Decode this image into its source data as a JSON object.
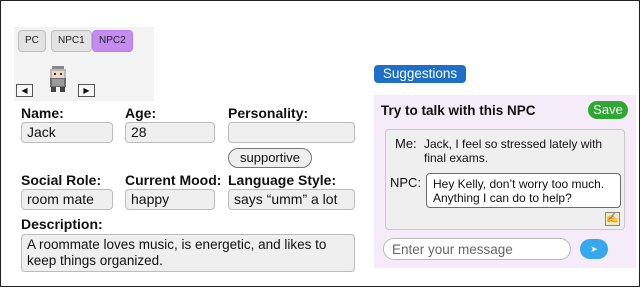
{
  "tabs": [
    "PC",
    "NPC1",
    "NPC2"
  ],
  "active_tab": "NPC2",
  "avatar": {
    "prev": "◀",
    "next": "▶"
  },
  "form": {
    "name": {
      "label": "Name:",
      "value": "Jack"
    },
    "age": {
      "label": "Age:",
      "value": "28"
    },
    "personality": {
      "label": "Personality:",
      "value": "",
      "tag": "supportive"
    },
    "social_role": {
      "label": "Social Role:",
      "value": "room mate"
    },
    "current_mood": {
      "label": "Current Mood:",
      "value": "happy"
    },
    "language_style": {
      "label": "Language Style:",
      "value": "says “umm” a lot"
    },
    "description": {
      "label": "Description:",
      "value": "A roommate loves music, is energetic, and likes to keep things organized."
    }
  },
  "suggestions": {
    "button_label": "Suggestions",
    "title": "Try to talk with this NPC",
    "save_label": "Save",
    "chat": {
      "me_label": "Me:",
      "me_text": "Jack, I feel so stressed lately with final exams.",
      "npc_label": "NPC:",
      "npc_text": "Hey Kelly, don’t worry too much. Anything I can do to help?",
      "edit_icon": "✍"
    },
    "input_placeholder": "Enter your message",
    "send_icon": "➤"
  },
  "colors": {
    "active_tab": "#c58cf0",
    "suggestions_button": "#1f6fc9",
    "save_button": "#2ea832",
    "send_button": "#36a8ee",
    "panel_bg": "#f6ecf9"
  }
}
